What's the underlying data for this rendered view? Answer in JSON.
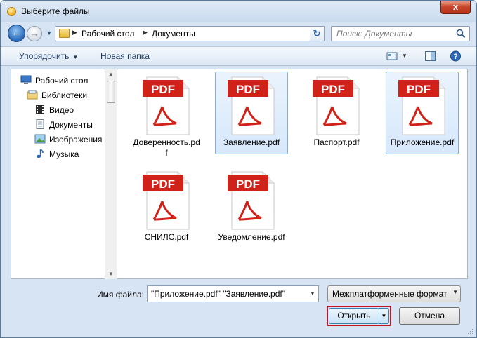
{
  "window": {
    "title": "Выберите файлы",
    "close_glyph": "x"
  },
  "address": {
    "crumbs": [
      "Рабочий стол",
      "Документы"
    ],
    "search_placeholder": "Поиск: Документы"
  },
  "toolbar": {
    "organize_label": "Упорядочить",
    "new_folder_label": "Новая папка",
    "help_glyph": "?"
  },
  "sidebar": {
    "items": [
      {
        "label": "Рабочий стол",
        "icon": "desktop-icon"
      },
      {
        "label": "Библиотеки",
        "icon": "libraries-icon"
      },
      {
        "label": "Видео",
        "icon": "video-icon"
      },
      {
        "label": "Документы",
        "icon": "documents-icon"
      },
      {
        "label": "Изображения",
        "icon": "images-icon"
      },
      {
        "label": "Музыка",
        "icon": "music-icon"
      }
    ]
  },
  "files": [
    {
      "name": "Доверенность.pdf",
      "selected": false,
      "badge": "PDF"
    },
    {
      "name": "Заявление.pdf",
      "selected": true,
      "badge": "PDF"
    },
    {
      "name": "Паспорт.pdf",
      "selected": false,
      "badge": "PDF"
    },
    {
      "name": "Приложение.pdf",
      "selected": true,
      "badge": "PDF"
    },
    {
      "name": "СНИЛС.pdf",
      "selected": false,
      "badge": "PDF"
    },
    {
      "name": "Уведомление.pdf",
      "selected": false,
      "badge": "PDF"
    }
  ],
  "bottom": {
    "filename_label": "Имя файла:",
    "filename_value": "\"Приложение.pdf\" \"Заявление.pdf\"",
    "filter_value": "Межплатформенные формат",
    "open_label": "Открыть",
    "cancel_label": "Отмена"
  },
  "colors": {
    "pdf_red": "#d1221a",
    "selection_border": "#84acdd",
    "open_highlight": "#c0141f"
  }
}
